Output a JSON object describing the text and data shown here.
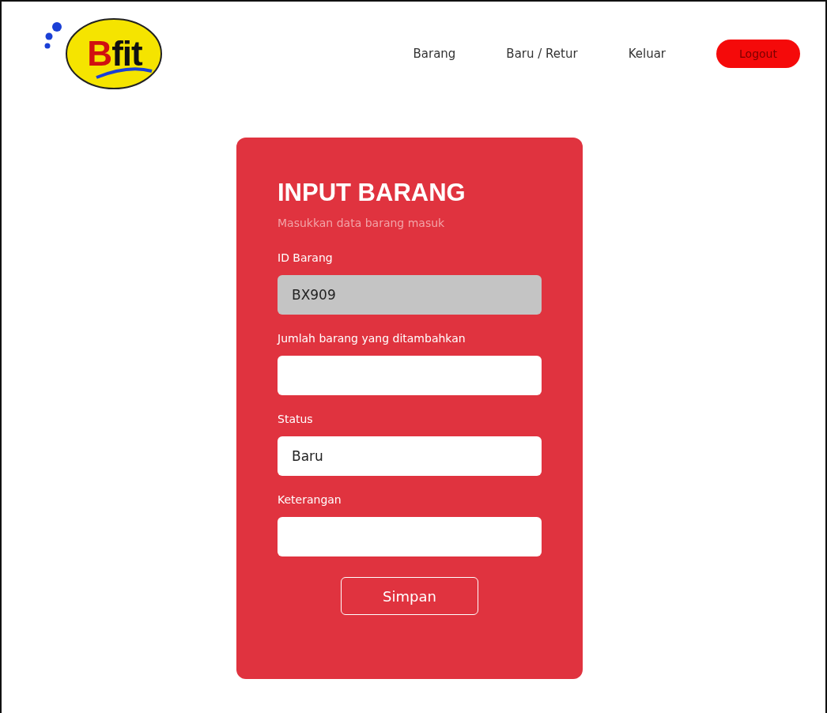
{
  "logo": {
    "initial": "B",
    "rest": "fit"
  },
  "nav": [
    {
      "kind": "link",
      "label": "Barang"
    },
    {
      "kind": "link",
      "label": "Baru / Retur"
    },
    {
      "kind": "link",
      "label": "Keluar"
    },
    {
      "kind": "button",
      "label": "Logout"
    }
  ],
  "form": {
    "title": "INPUT BARANG",
    "subtitle": "Masukkan data barang masuk",
    "fields": [
      {
        "label": "ID Barang",
        "value": "BX909",
        "disabled": true
      },
      {
        "label": "Jumlah barang yang ditambahkan",
        "disabled": false
      },
      {
        "label": "Status",
        "value": "Baru",
        "disabled": false
      },
      {
        "label": "Keterangan",
        "disabled": false
      }
    ],
    "submit": "Simpan"
  }
}
